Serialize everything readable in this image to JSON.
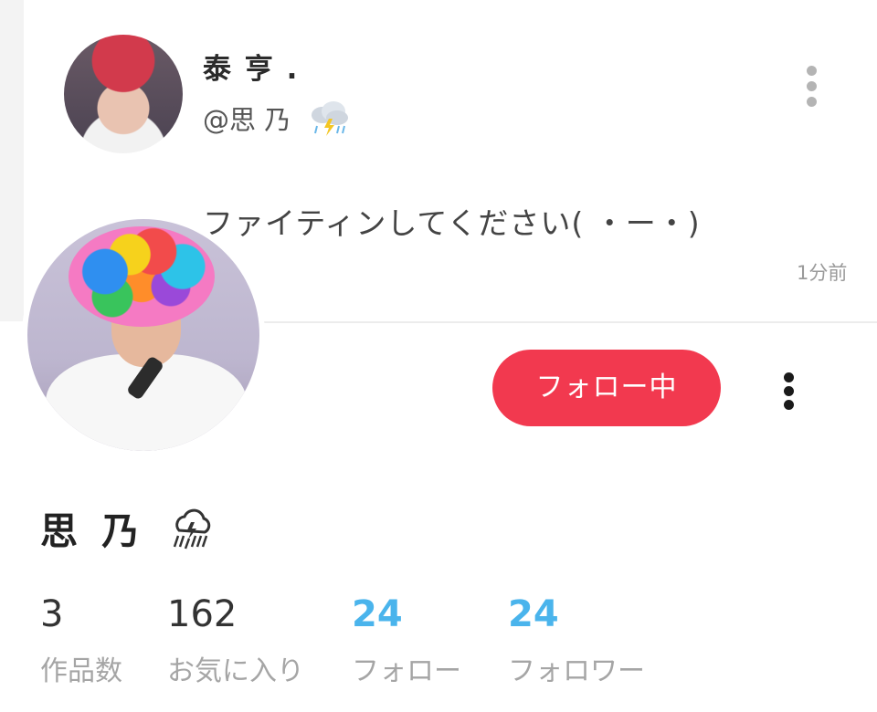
{
  "post": {
    "author_name": "泰 亨 .",
    "author_handle": "@思 乃",
    "handle_icon": "thunder-rain-cloud-icon",
    "text": "ファイティンしてください( ・ー・)",
    "time": "1分前"
  },
  "profile": {
    "follow_button_label": "フォロー中",
    "name": "思 乃",
    "name_icon": "thunder-rain-cloud-icon",
    "stats": [
      {
        "value": "3",
        "label": "作品数"
      },
      {
        "value": "162",
        "label": "お気に入り"
      },
      {
        "value": "24",
        "label": "フォロー"
      },
      {
        "value": "24",
        "label": "フォロワー"
      }
    ]
  },
  "colors": {
    "accent": "#f2394f",
    "link_blue": "#4ab4ec",
    "muted": "#a5a5a5"
  }
}
